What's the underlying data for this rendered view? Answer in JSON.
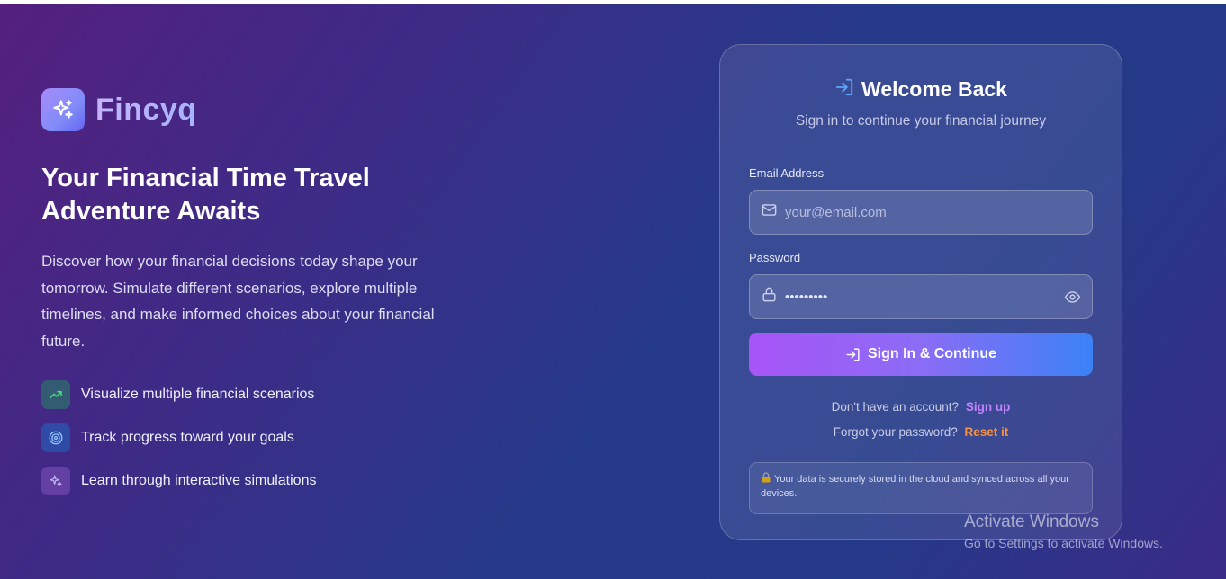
{
  "brand": {
    "name": "Fincyq",
    "logo_icon": "sparkles-icon"
  },
  "hero": {
    "title": "Your Financial Time Travel Adventure Awaits",
    "description": "Discover how your financial decisions today shape your tomorrow. Simulate different scenarios, explore multiple timelines, and make informed choices about your financial future.",
    "features": [
      {
        "icon": "trending-up-icon",
        "label": "Visualize multiple financial scenarios"
      },
      {
        "icon": "target-icon",
        "label": "Track progress toward your goals"
      },
      {
        "icon": "sparkles-icon",
        "label": "Learn through interactive simulations"
      }
    ]
  },
  "login": {
    "title": "Welcome Back",
    "subtitle": "Sign in to continue your financial journey",
    "email_label": "Email Address",
    "email_placeholder": "your@email.com",
    "password_label": "Password",
    "password_value": "password1",
    "submit_label": "Sign In & Continue",
    "no_account_text": "Don't have an account?",
    "signup_link": "Sign up",
    "forgot_text": "Forgot your password?",
    "reset_link": "Reset it",
    "security_note": "Your data is securely stored in the cloud and synced across all your devices."
  },
  "watermark": {
    "title": "Activate Windows",
    "subtitle": "Go to Settings to activate Windows."
  },
  "colors": {
    "accent_purple": "#a855f7",
    "accent_blue": "#3b82f6",
    "signup_link": "#c084fc",
    "reset_link": "#fb923c"
  }
}
